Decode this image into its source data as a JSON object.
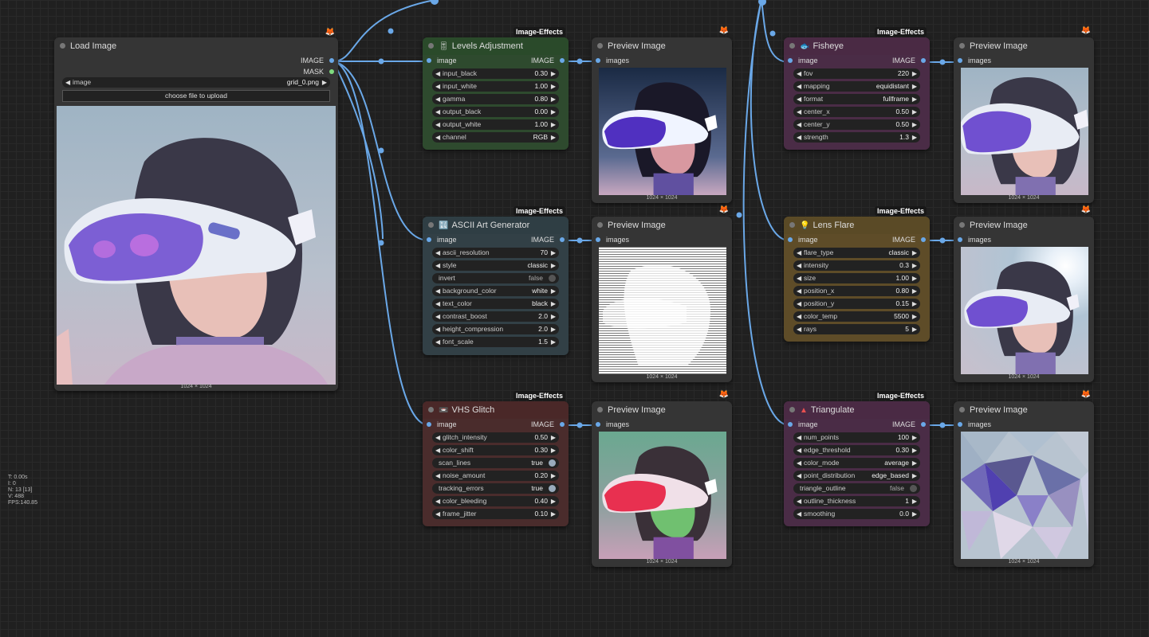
{
  "stats": {
    "time": "T: 0.00s",
    "i": "I: 0",
    "nodes": "N: 13 [13]",
    "vertices": "V: 488",
    "fps": "FPS:140.85"
  },
  "load_image": {
    "title": "Load Image",
    "out_image": "IMAGE",
    "out_mask": "MASK",
    "widget_label": "image",
    "widget_value": "grid_0.png",
    "upload_label": "choose file to upload",
    "caption": "1024 × 1024"
  },
  "levels": {
    "badge": "Image-Effects",
    "title": "Levels Adjustment",
    "in_label": "image",
    "out_label": "IMAGE",
    "widgets": [
      {
        "label": "input_black",
        "value": "0.30"
      },
      {
        "label": "input_white",
        "value": "1.00"
      },
      {
        "label": "gamma",
        "value": "0.80"
      },
      {
        "label": "output_black",
        "value": "0.00"
      },
      {
        "label": "output_white",
        "value": "1.00"
      },
      {
        "label": "channel",
        "value": "RGB"
      }
    ]
  },
  "ascii": {
    "badge": "Image-Effects",
    "title": "ASCII Art Generator",
    "in_label": "image",
    "out_label": "IMAGE",
    "widgets": [
      {
        "label": "ascii_resolution",
        "value": "70"
      },
      {
        "label": "style",
        "value": "classic"
      },
      {
        "label": "invert",
        "value": "false"
      },
      {
        "label": "background_color",
        "value": "white"
      },
      {
        "label": "text_color",
        "value": "black"
      },
      {
        "label": "contrast_boost",
        "value": "2.0"
      },
      {
        "label": "height_compression",
        "value": "2.0"
      },
      {
        "label": "font_scale",
        "value": "1.5"
      }
    ]
  },
  "vhs": {
    "badge": "Image-Effects",
    "title": "VHS Glitch",
    "in_label": "image",
    "out_label": "IMAGE",
    "widgets": [
      {
        "label": "glitch_intensity",
        "value": "0.50"
      },
      {
        "label": "color_shift",
        "value": "0.30"
      },
      {
        "label": "scan_lines",
        "value": "true"
      },
      {
        "label": "noise_amount",
        "value": "0.20"
      },
      {
        "label": "tracking_errors",
        "value": "true"
      },
      {
        "label": "color_bleeding",
        "value": "0.40"
      },
      {
        "label": "frame_jitter",
        "value": "0.10"
      }
    ]
  },
  "fisheye": {
    "badge": "Image-Effects",
    "title": "Fisheye",
    "in_label": "image",
    "out_label": "IMAGE",
    "widgets": [
      {
        "label": "fov",
        "value": "220"
      },
      {
        "label": "mapping",
        "value": "equidistant"
      },
      {
        "label": "format",
        "value": "fullframe"
      },
      {
        "label": "center_x",
        "value": "0.50"
      },
      {
        "label": "center_y",
        "value": "0.50"
      },
      {
        "label": "strength",
        "value": "1.3"
      }
    ]
  },
  "lens": {
    "badge": "Image-Effects",
    "title": "Lens Flare",
    "in_label": "image",
    "out_label": "IMAGE",
    "widgets": [
      {
        "label": "flare_type",
        "value": "classic"
      },
      {
        "label": "intensity",
        "value": "0.3"
      },
      {
        "label": "size",
        "value": "1.00"
      },
      {
        "label": "position_x",
        "value": "0.80"
      },
      {
        "label": "position_y",
        "value": "0.15"
      },
      {
        "label": "color_temp",
        "value": "5500"
      },
      {
        "label": "rays",
        "value": "5"
      }
    ]
  },
  "tri": {
    "badge": "Image-Effects",
    "title": "Triangulate",
    "in_label": "image",
    "out_label": "IMAGE",
    "widgets": [
      {
        "label": "num_points",
        "value": "100"
      },
      {
        "label": "edge_threshold",
        "value": "0.30"
      },
      {
        "label": "color_mode",
        "value": "average"
      },
      {
        "label": "point_distribution",
        "value": "edge_based"
      },
      {
        "label": "triangle_outline",
        "value": "false"
      },
      {
        "label": "outline_thickness",
        "value": "1"
      },
      {
        "label": "smoothing",
        "value": "0.0"
      }
    ]
  },
  "preview": {
    "title": "Preview Image",
    "in_label": "images",
    "caption": "1024 × 1024"
  },
  "colors": {
    "canvas": "#202020",
    "wire": "#6aa8e8",
    "levels_title": "#2a4a2a",
    "ascii_title": "#2f3e44",
    "vhs_title": "#4a2828",
    "fisheye_title": "#4a2a44",
    "lens_title": "#5a4a26",
    "tri_title": "#4a2a44"
  }
}
